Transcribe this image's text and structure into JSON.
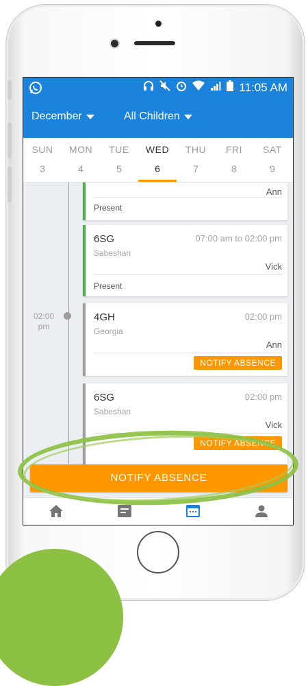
{
  "status_bar": {
    "time": "11:05 AM",
    "icons": [
      "whatsapp-icon",
      "headphones-icon",
      "mute-icon",
      "alarm-icon",
      "wifi-icon",
      "signal-icon",
      "battery-icon"
    ]
  },
  "header": {
    "month": "December",
    "children_filter": "All Children"
  },
  "week": [
    {
      "name": "SUN",
      "num": "3"
    },
    {
      "name": "MON",
      "num": "4"
    },
    {
      "name": "TUE",
      "num": "5"
    },
    {
      "name": "WED",
      "num": "6",
      "selected": true
    },
    {
      "name": "THU",
      "num": "7"
    },
    {
      "name": "FRI",
      "num": "8"
    },
    {
      "name": "SAT",
      "num": "9"
    }
  ],
  "timeline": {
    "slot_label_line1": "02:00",
    "slot_label_line2": "pm"
  },
  "cards": [
    {
      "teacher": "Ann",
      "status": "Present"
    },
    {
      "class": "6SG",
      "time": "07:00 am to 02:00 pm",
      "location": "Sabeshan",
      "teacher": "Vick",
      "status": "Present"
    },
    {
      "class": "4GH",
      "time": "02:00 pm",
      "location": "Georgia",
      "teacher": "Ann",
      "action": "NOTIFY ABSENCE"
    },
    {
      "class": "6SG",
      "time": "02:00 pm",
      "location": "Sabeshan",
      "teacher": "Vick",
      "action": "NOTIFY ABSENCE"
    }
  ],
  "main_button": "NOTIFY ABSENCE",
  "bottom_nav": [
    "home-icon",
    "notes-icon",
    "calendar-icon",
    "profile-icon"
  ],
  "colors": {
    "primary": "#1c83dc",
    "accent": "#ff9800",
    "present": "#4caf50",
    "highlight": "#8cc043"
  }
}
